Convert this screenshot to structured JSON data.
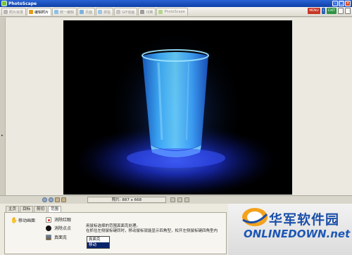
{
  "app": {
    "title": "PhotoScape"
  },
  "tabs": [
    {
      "label": "照片目录",
      "active": false,
      "icon": "photo-folder-icon",
      "color": "#b7b7b7"
    },
    {
      "label": "编辑照片",
      "active": true,
      "icon": "edit-photo-icon",
      "color": "#e39a1c"
    },
    {
      "label": "统一编辑",
      "active": false,
      "icon": "batch-edit-icon",
      "color": "#8cc0e6"
    },
    {
      "label": "页面",
      "active": false,
      "icon": "page-icon",
      "color": "#7fb2db"
    },
    {
      "label": "拼贴",
      "active": false,
      "icon": "combine-icon",
      "color": "#9dc6e8"
    },
    {
      "label": "GIF动画",
      "active": false,
      "icon": "gif-animation-icon",
      "color": "#c4c4c4"
    },
    {
      "label": "印刷",
      "active": false,
      "icon": "print-icon",
      "color": "#9d9d9d"
    },
    {
      "label": "PhotoScape",
      "active": false,
      "icon": "photoscape-icon",
      "color": "#b8d58e"
    }
  ],
  "top_buttons": {
    "menu": "MENU",
    "info": "i",
    "exit": "EXIT"
  },
  "status": {
    "image_size": "照片: 887 x 668"
  },
  "lower_tabs": [
    {
      "label": "主页",
      "active": false
    },
    {
      "label": "目标",
      "active": false
    },
    {
      "label": "剪切",
      "active": false
    },
    {
      "label": "范围",
      "active": true
    }
  ],
  "tools": {
    "mode_label": "移动画面",
    "tool1": "消除红眼",
    "tool2": "消除点点",
    "tool3": "真面克"
  },
  "instruction": {
    "line1": "用鼠标选择的范围真面克处理。",
    "line2": "在抓住左侧鼠标键同时，移动鼠标就能显示四角型，松开左侧鼠标键四角型内"
  },
  "dropdown": {
    "options": [
      "真面克",
      "移动"
    ],
    "selected_index": 1
  },
  "watermark": {
    "cn": "华军软件园",
    "en": "ONLINEDOWN.net"
  }
}
